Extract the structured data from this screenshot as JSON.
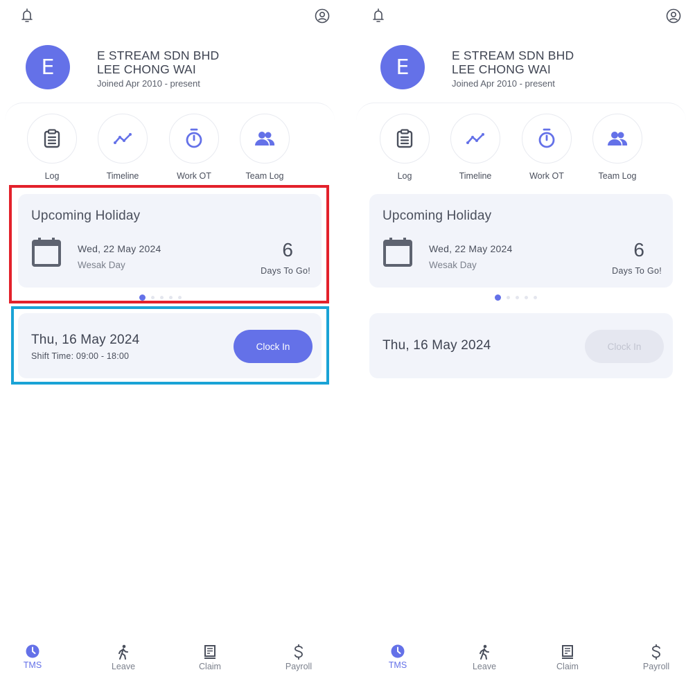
{
  "colors": {
    "accent": "#6471e8",
    "card_background": "#f2f4fa",
    "disabled_button": "#e5e7f0",
    "red_highlight": "#e3212b",
    "blue_highlight": "#1aa3d6"
  },
  "screens": [
    {
      "profile": {
        "avatar_initial": "E",
        "company": "E STREAM SDN BHD",
        "name": "LEE CHONG WAI",
        "joined": "Joined Apr 2010 - present"
      },
      "quick_actions": [
        {
          "label": "Log",
          "icon": "clipboard-icon"
        },
        {
          "label": "Timeline",
          "icon": "trend-line-icon"
        },
        {
          "label": "Work OT",
          "icon": "stopwatch-icon"
        },
        {
          "label": "Team Log",
          "icon": "team-icon"
        }
      ],
      "holiday": {
        "title": "Upcoming Holiday",
        "date": "Wed, 22 May 2024",
        "name": "Wesak Day",
        "days": "6",
        "days_label": "Days To Go!",
        "carousel_pages": 5,
        "carousel_active": 1
      },
      "clock": {
        "date": "Thu, 16 May 2024",
        "shift": "Shift Time: 09:00 - 18:00",
        "button_label": "Clock In",
        "button_enabled": true
      },
      "nav": [
        {
          "label": "TMS",
          "icon": "clock-icon",
          "active": true
        },
        {
          "label": "Leave",
          "icon": "walking-person-icon",
          "active": false
        },
        {
          "label": "Claim",
          "icon": "receipt-icon",
          "active": false
        },
        {
          "label": "Payroll",
          "icon": "dollar-icon",
          "active": false
        }
      ]
    },
    {
      "profile": {
        "avatar_initial": "E",
        "company": "E STREAM SDN BHD",
        "name": "LEE CHONG WAI",
        "joined": "Joined Apr 2010 - present"
      },
      "quick_actions": [
        {
          "label": "Log",
          "icon": "clipboard-icon"
        },
        {
          "label": "Timeline",
          "icon": "trend-line-icon"
        },
        {
          "label": "Work OT",
          "icon": "stopwatch-icon"
        },
        {
          "label": "Team Log",
          "icon": "team-icon"
        }
      ],
      "holiday": {
        "title": "Upcoming Holiday",
        "date": "Wed, 22 May 2024",
        "name": "Wesak Day",
        "days": "6",
        "days_label": "Days To Go!",
        "carousel_pages": 5,
        "carousel_active": 1
      },
      "clock": {
        "date": "Thu, 16 May 2024",
        "button_label": "Clock In",
        "button_enabled": false
      },
      "nav": [
        {
          "label": "TMS",
          "icon": "clock-icon",
          "active": true
        },
        {
          "label": "Leave",
          "icon": "walking-person-icon",
          "active": false
        },
        {
          "label": "Claim",
          "icon": "receipt-icon",
          "active": false
        },
        {
          "label": "Payroll",
          "icon": "dollar-icon",
          "active": false
        }
      ]
    }
  ]
}
